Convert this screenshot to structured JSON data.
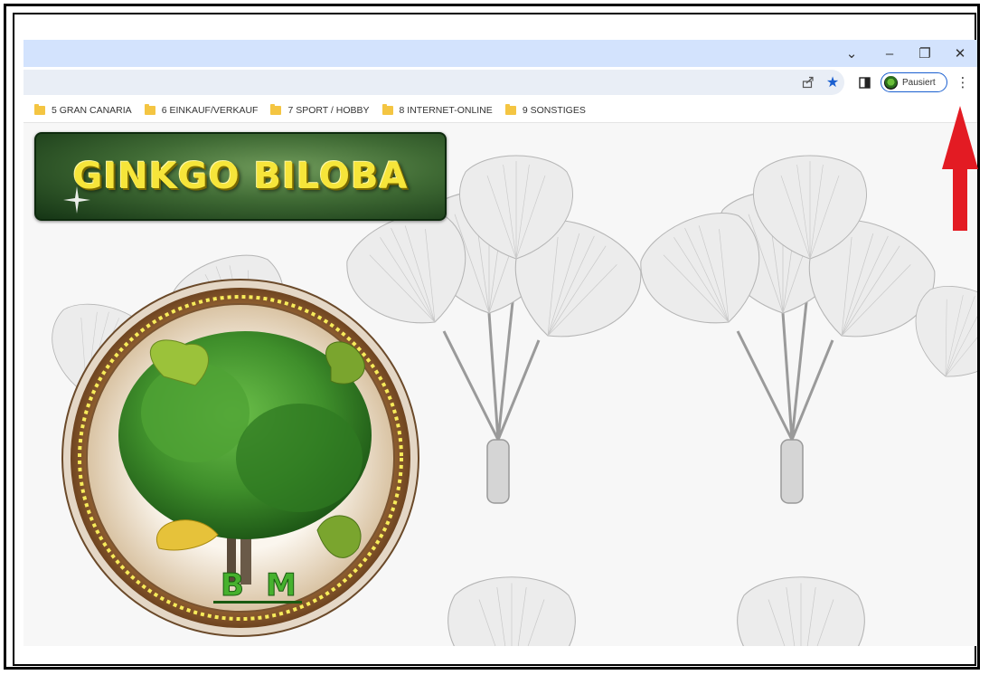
{
  "window": {
    "controls": {
      "tab_search": "⌄",
      "minimize": "–",
      "restore": "❐",
      "close": "✕"
    }
  },
  "toolbar": {
    "share_icon": "share-icon",
    "bookmark_star": "★",
    "side_panel_icon": "side-panel-icon",
    "profile_label": "Pausiert",
    "menu_icon": "⋮"
  },
  "bookmarks": [
    {
      "label": "5 GRAN CANARIA"
    },
    {
      "label": "6 EINKAUF/VERKAUF"
    },
    {
      "label": "7 SPORT / HOBBY"
    },
    {
      "label": "8 INTERNET-ONLINE"
    },
    {
      "label": "9 SONSTIGES"
    }
  ],
  "page": {
    "banner_title": "GINKGO BILOBA",
    "medallion_initials": [
      "B",
      "M"
    ]
  },
  "colors": {
    "titlebar": "#d3e3fd",
    "omnibox": "#e9eef6",
    "banner_text": "#f6e53a",
    "annotation_arrow": "#e31b23",
    "profile_ring": "#1a5fd0"
  }
}
